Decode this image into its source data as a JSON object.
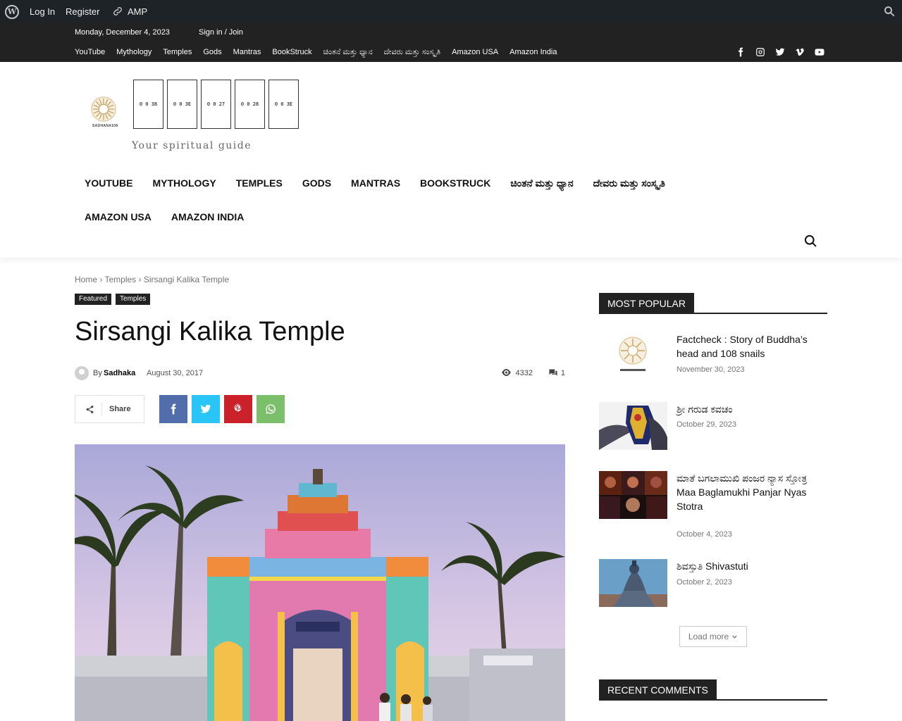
{
  "adminbar": {
    "login": "Log In",
    "register": "Register",
    "amp": "AMP"
  },
  "topbar": {
    "date": "Monday, December 4, 2023",
    "signin": "Sign in / Join",
    "menu": [
      "YouTube",
      "Mythology",
      "Temples",
      "Gods",
      "Mantras",
      "BookStruck",
      "ಚಿಂತನೆ ಮತ್ತು ಧ್ಯಾನ",
      "ದೇವರು ಮತ್ತು ಸಂಸ್ಕೃತಿ",
      "Amazon USA",
      "Amazon India"
    ],
    "social_icons": [
      "facebook-icon",
      "instagram-icon",
      "twitter-icon",
      "vimeo-icon",
      "youtube-icon"
    ]
  },
  "header": {
    "logo_caption": "SADHANA108",
    "logo_glyphs": [
      "0 0 38",
      "0 0 3E",
      "0 0 27",
      "0 0 28",
      "0 0 3E"
    ],
    "tagline": "Your spiritual guide",
    "menu_row1": [
      "YOUTUBE",
      "MYTHOLOGY",
      "TEMPLES",
      "GODS",
      "MANTRAS",
      "BOOKSTRUCK",
      "ಚಿಂತನೆ ಮತ್ತು ಧ್ಯಾನ",
      "ದೇವರು ಮತ್ತು ಸಂಸ್ಕೃತಿ"
    ],
    "menu_row2": [
      "AMAZON USA",
      "AMAZON INDIA"
    ]
  },
  "breadcrumb": {
    "home": "Home",
    "sep1": "›",
    "section": "Temples",
    "sep2": "›",
    "current": "Sirsangi Kalika Temple"
  },
  "tags": [
    "Featured",
    "Temples"
  ],
  "post": {
    "title": "Sirsangi Kalika Temple",
    "by": "By",
    "author": "Sadhaka",
    "date": "August 30, 2017",
    "views": "4332",
    "comments": "1",
    "share_label": "Share"
  },
  "sidebar": {
    "popular_title": "MOST POPULAR",
    "items": [
      {
        "title": "Factcheck : Story of Buddha’s head and 108 snails",
        "date": "November 30, 2023"
      },
      {
        "title": "ಶ್ರೀ ಗರುಡ ಕವಚಂ",
        "date": "October 29, 2023"
      },
      {
        "title": "ಮಾತೆ ಬಗಲಾಮುಖಿ ಪಂಜರ ನ್ಯಾಸ ಸ್ತೋತ್ರ Maa Baglamukhi Panjar Nyas Stotra",
        "date": "October 4, 2023"
      },
      {
        "title": "ಶಿವಸ್ತುತಿ Shivastuti",
        "date": "October 2, 2023"
      }
    ],
    "load_more": "Load more",
    "recent_title": "RECENT COMMENTS"
  },
  "colors": {
    "admin_bar": "#1d2327",
    "top_bar": "#222222",
    "facebook": "#516eab",
    "twitter": "#29c5f6",
    "pinterest": "#ca212a",
    "whatsapp": "#7bbf6a"
  }
}
